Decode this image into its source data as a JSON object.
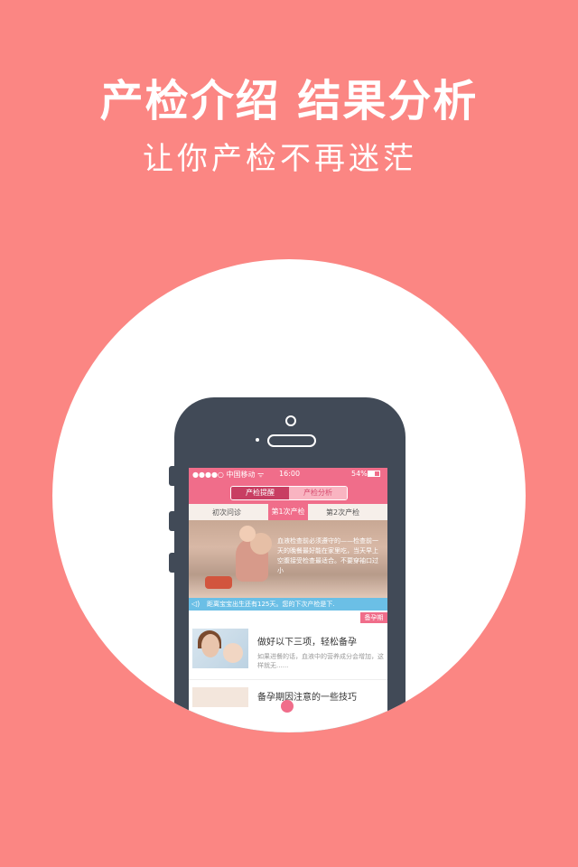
{
  "headline": "产检介绍  结果分析",
  "subline": "让你产检不再迷茫",
  "phone": {
    "status": {
      "carrier": "●●●●○ 中国移动 ᯤ",
      "time": "16:00",
      "battery": "54%"
    },
    "segments": [
      {
        "label": "产检提醒"
      },
      {
        "label": "产检分析"
      }
    ],
    "tabs": [
      {
        "label": "初次问诊"
      },
      {
        "label": "第1次产检"
      },
      {
        "label": "第2次产检"
      }
    ],
    "hero_text": "血液检查前必须遵守的——检查前一天的晚餐最好能在家里吃，当天早上空腹接受检查最适合。不要穿袖口过小",
    "notice": "距离宝宝出生还有125天。您的下次产检是下.",
    "ribbon": "备孕期",
    "article1": {
      "title": "做好以下三项，轻松备孕",
      "desc": "如果进餐的话，血液中的营养成分会增加，这样就无......"
    },
    "article2": {
      "title": "备孕期因注意的一些技巧"
    }
  }
}
